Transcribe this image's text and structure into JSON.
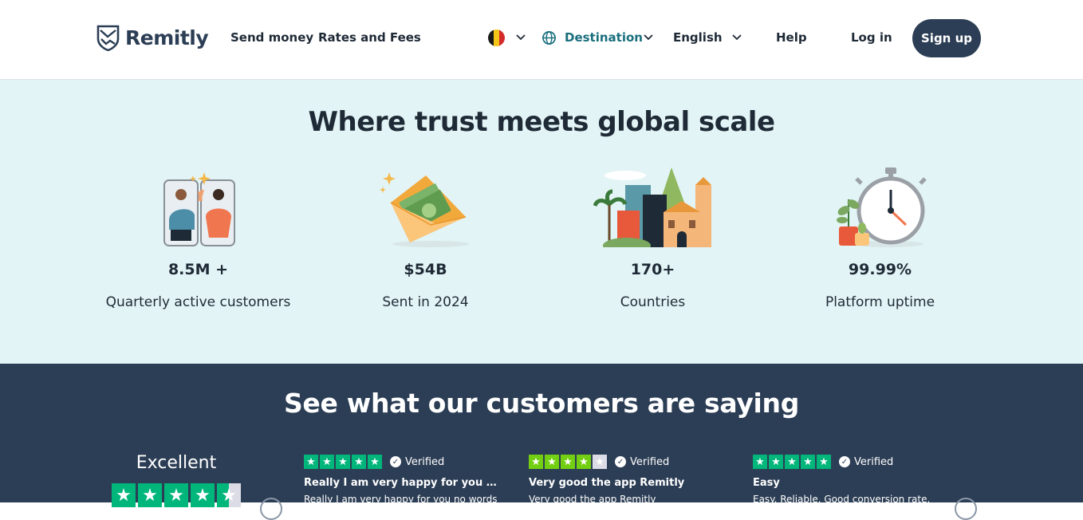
{
  "header": {
    "brand": "Remitly",
    "nav": {
      "send_money": "Send money",
      "rates_fees": "Rates and Fees",
      "destination": "Destination",
      "language": "English",
      "help": "Help",
      "login": "Log in",
      "signup": "Sign up"
    },
    "flag_colors": [
      "#1a1a1a",
      "#f5c518",
      "#d42a2a"
    ],
    "accent": "#2c3e55"
  },
  "stats": {
    "title": "Where trust meets global scale",
    "items": [
      {
        "value": "8.5M +",
        "label": "Quarterly active customers",
        "icon": "high-five-icon"
      },
      {
        "value": "$54B",
        "label": "Sent in 2024",
        "icon": "money-envelope-icon"
      },
      {
        "value": "170+",
        "label": "Countries",
        "icon": "cityscape-icon"
      },
      {
        "value": "99.99%",
        "label": "Platform uptime",
        "icon": "stopwatch-icon"
      }
    ]
  },
  "reviews": {
    "title": "See what our customers are saying",
    "rating_word": "Excellent",
    "overall_stars": 4.5,
    "items": [
      {
        "stars": 5,
        "verified": "Verified",
        "title": "Really I am very happy for you no...",
        "body": "Really I am very happy for you no words"
      },
      {
        "stars": 4,
        "verified": "Verified",
        "title": "Very good the app Remitly",
        "body": "Very good the app Remitly"
      },
      {
        "stars": 5,
        "verified": "Verified",
        "title": "Easy",
        "body": "Easy. Reliable. Good conversion rate."
      }
    ]
  }
}
